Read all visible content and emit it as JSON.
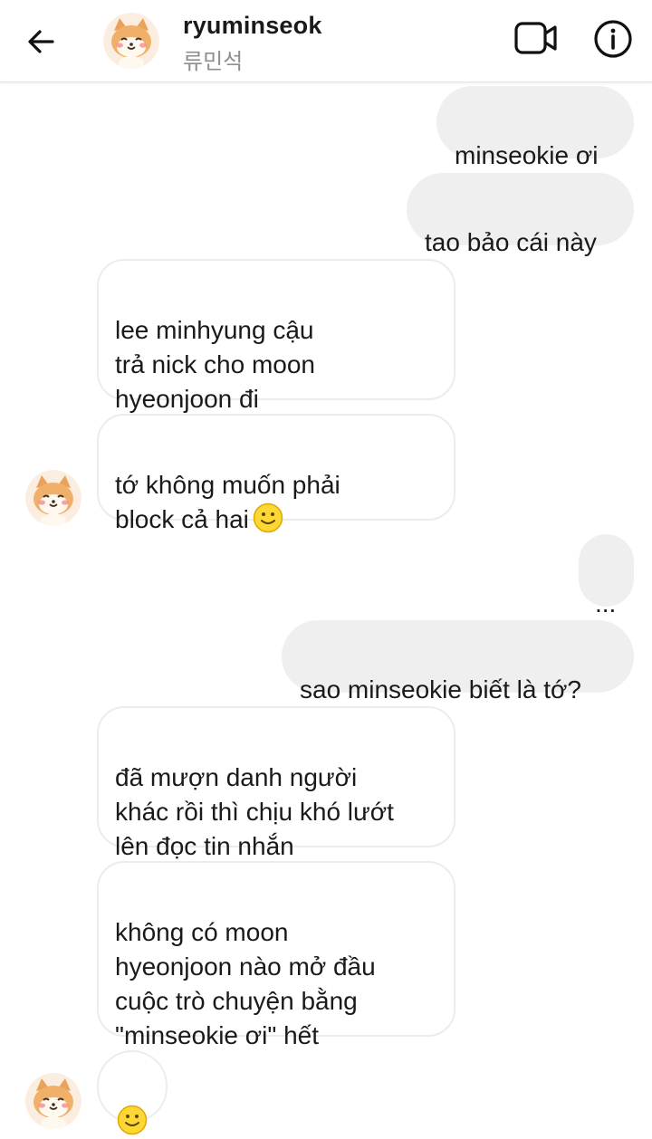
{
  "header": {
    "username": "ryuminseok",
    "subtitle": "류민석",
    "back_icon": "arrow-left-icon",
    "video_icon": "video-call-icon",
    "info_icon": "info-icon"
  },
  "colors": {
    "outgoing_bubble": "#efefef",
    "incoming_border": "#ececec",
    "emoji_yellow": "#fdd835"
  },
  "messages": [
    {
      "side": "out",
      "text": "minseokie ơi"
    },
    {
      "side": "out",
      "text": "tao bảo cái này"
    },
    {
      "side": "in",
      "text": "lee minhyung cậu\ntrả nick cho moon\nhyeonjoon đi"
    },
    {
      "side": "in",
      "text": "tớ không muốn phải\nblock cả hai",
      "emoji": "slightly-smiling-face-emoji"
    },
    {
      "side": "out",
      "text": "..."
    },
    {
      "side": "out",
      "text": "sao minseokie biết là tớ?"
    },
    {
      "side": "in",
      "text": "đã mượn danh người\nkhác rồi thì chịu khó lướt\nlên đọc tin nhắn"
    },
    {
      "side": "in",
      "text": "không có moon\nhyeonjoon nào mở đầu\ncuộc trò chuyện bằng\n\"minseokie ơi\" hết"
    },
    {
      "side": "in",
      "text": "",
      "emoji": "slightly-smiling-face-emoji"
    }
  ]
}
